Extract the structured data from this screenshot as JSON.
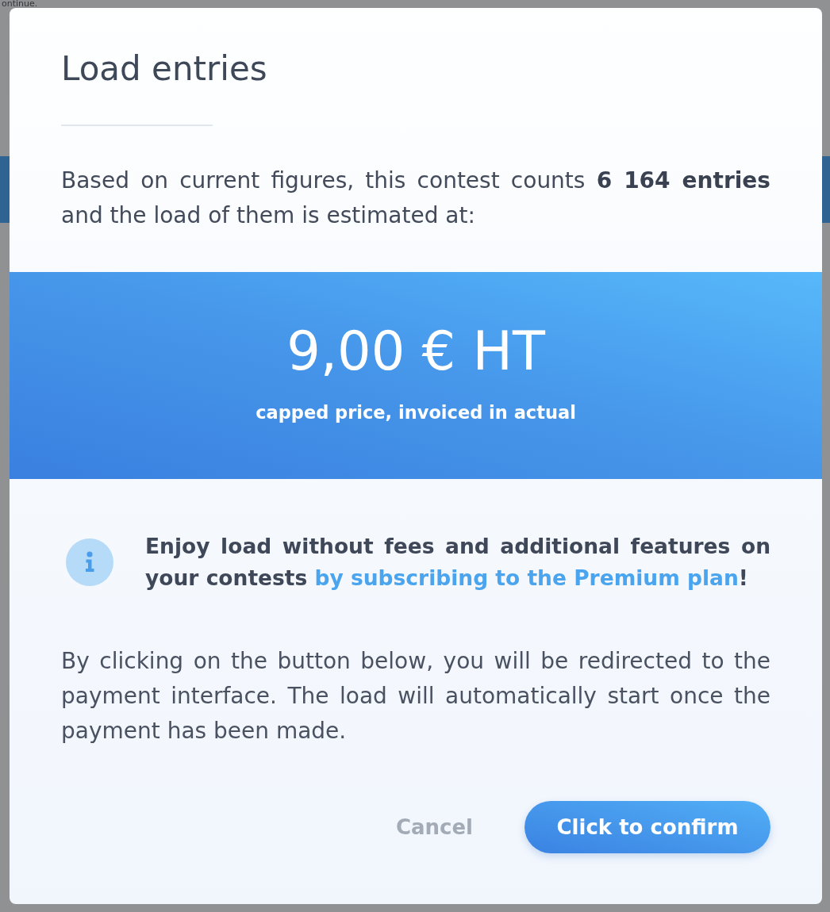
{
  "backdrop": {
    "text": "ontinue."
  },
  "dialog": {
    "title": "Load entries",
    "intro": "Based on current figures, this contest counts **6 164 entries** and the load of them is estimated at:",
    "price": {
      "amount": "9,00 € HT",
      "note": "capped price, invoiced in actual"
    },
    "promo": {
      "text": "Enjoy load without fees and additional features on your contests",
      "link": "by subscribing to the Premium plan",
      "end": "!"
    },
    "notice": "By clicking on the button below, you will be redirected to the payment interface. The load will automatically start once the payment has been made.",
    "buttons": [
      {
        "label": "Cancel",
        "kind": "text"
      },
      {
        "label": "Click to confirm",
        "kind": "primary"
      }
    ]
  }
}
